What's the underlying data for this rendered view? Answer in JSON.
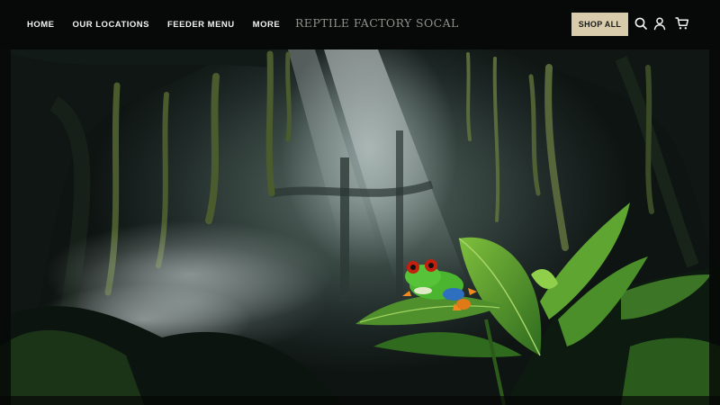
{
  "nav": {
    "items": [
      {
        "label": "HOME"
      },
      {
        "label": "OUR LOCATIONS"
      },
      {
        "label": "FEEDER MENU"
      },
      {
        "label": "MORE"
      }
    ]
  },
  "brand": {
    "name": "REPTILE FACTORY SOCAL"
  },
  "actions": {
    "shop_all": "SHOP ALL",
    "icons": [
      "search-icon",
      "account-icon",
      "cart-icon"
    ]
  },
  "hero": {
    "image": "rainforest-tree-frog-photo"
  },
  "colors": {
    "header_bg": "#070808",
    "nav_text": "#f2f2f2",
    "brand_text": "#8f908a",
    "shop_button_bg": "#d9ccac"
  }
}
